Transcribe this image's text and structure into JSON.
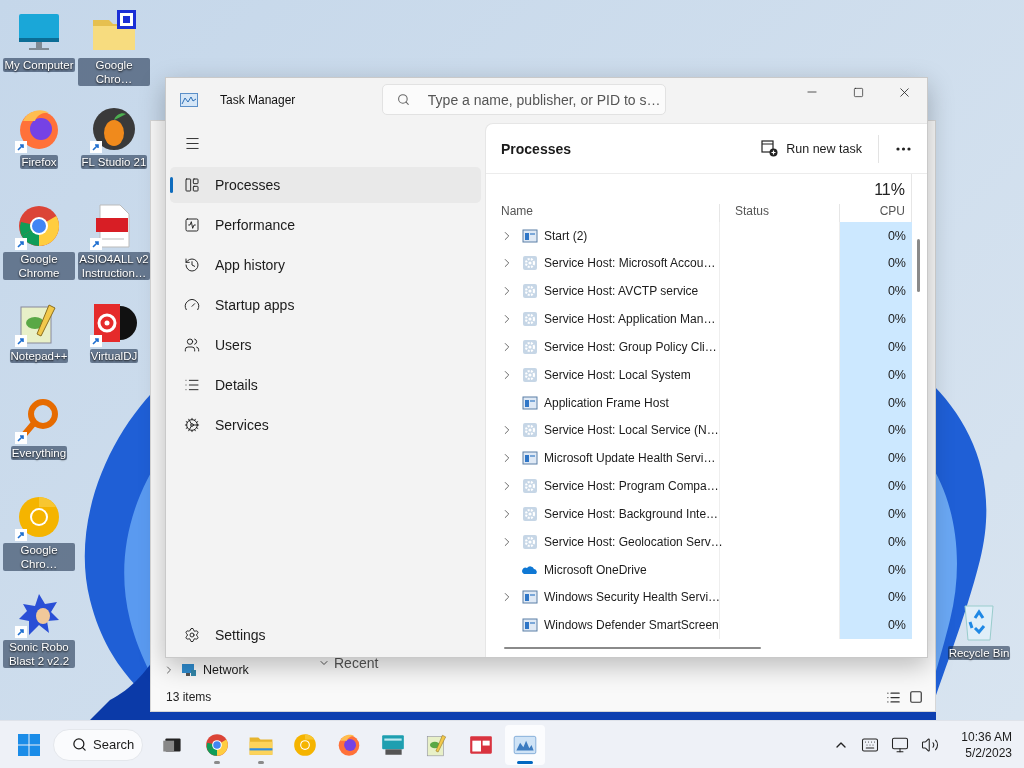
{
  "desktop": {
    "icon_columns": [
      {
        "icons": [
          {
            "label": "My Computer",
            "kind": "monitor",
            "shortcut": false
          },
          {
            "label": "Firefox",
            "kind": "firefox",
            "shortcut": true
          },
          {
            "label": "Google Chrome",
            "kind": "chrome",
            "shortcut": true
          },
          {
            "label": "Notepad++",
            "kind": "notepad",
            "shortcut": true
          },
          {
            "label": "Everything",
            "kind": "ring",
            "shortcut": true
          },
          {
            "label": "Google Chro…",
            "kind": "canary",
            "shortcut": true
          },
          {
            "label": "Sonic Robo Blast 2 v2.2",
            "kind": "figure",
            "shortcut": true
          }
        ]
      },
      {
        "icons": [
          {
            "label": "Google Chro…",
            "kind": "folder",
            "shortcut": false
          },
          {
            "label": "FL Studio 21",
            "kind": "fruit",
            "shortcut": true
          },
          {
            "label": "ASIO4ALL v2 Instruction…",
            "kind": "pdf",
            "shortcut": true
          },
          {
            "label": "VirtualDJ",
            "kind": "vinyl",
            "shortcut": true
          }
        ]
      }
    ],
    "recycle_bin": {
      "label": "Recycle Bin",
      "kind": "bin",
      "shortcut": false
    }
  },
  "explorer": {
    "nav_item": "Network",
    "section": "Recent",
    "status": "13 items"
  },
  "task_manager": {
    "title": "Task Manager",
    "search": {
      "placeholder": "Type a name, publisher, or PID to s…"
    },
    "nav": [
      {
        "label": "Processes",
        "kind": "processes",
        "selected": true
      },
      {
        "label": "Performance",
        "kind": "performance",
        "selected": false
      },
      {
        "label": "App history",
        "kind": "history",
        "selected": false
      },
      {
        "label": "Startup apps",
        "kind": "startup",
        "selected": false
      },
      {
        "label": "Users",
        "kind": "users",
        "selected": false
      },
      {
        "label": "Details",
        "kind": "details",
        "selected": false
      },
      {
        "label": "Services",
        "kind": "services",
        "selected": false
      }
    ],
    "settings": "Settings",
    "heading": "Processes",
    "run_task": "Run new task",
    "columns": {
      "name": "Name",
      "status": "Status",
      "cpu_total": "11%",
      "cpu": "CPU"
    },
    "rows": [
      {
        "name": "Start (2)",
        "kind": "window",
        "expandable": true,
        "cpu": "0%"
      },
      {
        "name": "Service Host: Microsoft Accou…",
        "kind": "service",
        "expandable": true,
        "cpu": "0%"
      },
      {
        "name": "Service Host: AVCTP service",
        "kind": "service",
        "expandable": true,
        "cpu": "0%"
      },
      {
        "name": "Service Host: Application Man…",
        "kind": "service",
        "expandable": true,
        "cpu": "0%"
      },
      {
        "name": "Service Host: Group Policy Cli…",
        "kind": "service",
        "expandable": true,
        "cpu": "0%"
      },
      {
        "name": "Service Host: Local System",
        "kind": "service",
        "expandable": true,
        "cpu": "0%"
      },
      {
        "name": "Application Frame Host",
        "kind": "window",
        "expandable": false,
        "cpu": "0%"
      },
      {
        "name": "Service Host: Local Service (N…",
        "kind": "service",
        "expandable": true,
        "cpu": "0%"
      },
      {
        "name": "Microsoft Update Health Servi…",
        "kind": "window",
        "expandable": true,
        "cpu": "0%"
      },
      {
        "name": "Service Host: Program Compa…",
        "kind": "service",
        "expandable": true,
        "cpu": "0%"
      },
      {
        "name": "Service Host: Background Inte…",
        "kind": "service",
        "expandable": true,
        "cpu": "0%"
      },
      {
        "name": "Service Host: Geolocation Serv…",
        "kind": "service",
        "expandable": true,
        "cpu": "0%"
      },
      {
        "name": "Microsoft OneDrive",
        "kind": "cloud",
        "expandable": false,
        "cpu": "0%"
      },
      {
        "name": "Windows Security Health Servi…",
        "kind": "window",
        "expandable": true,
        "cpu": "0%"
      },
      {
        "name": "Windows Defender SmartScreen",
        "kind": "window",
        "expandable": false,
        "cpu": "0%"
      }
    ]
  },
  "taskbar": {
    "search": "Search",
    "apps": [
      {
        "kind": "taskview",
        "running": false,
        "selected": false
      },
      {
        "kind": "chrome",
        "running": true,
        "selected": false
      },
      {
        "kind": "folder",
        "running": true,
        "selected": false
      },
      {
        "kind": "canary",
        "running": false,
        "selected": false
      },
      {
        "kind": "firefox",
        "running": false,
        "selected": false
      },
      {
        "kind": "remote",
        "running": false,
        "selected": false
      },
      {
        "kind": "notepad",
        "running": false,
        "selected": false
      },
      {
        "kind": "redwindow",
        "running": false,
        "selected": false
      },
      {
        "kind": "taskmgr",
        "running": true,
        "selected": true
      }
    ],
    "time": "10:36 AM",
    "date": "5/2/2023"
  }
}
